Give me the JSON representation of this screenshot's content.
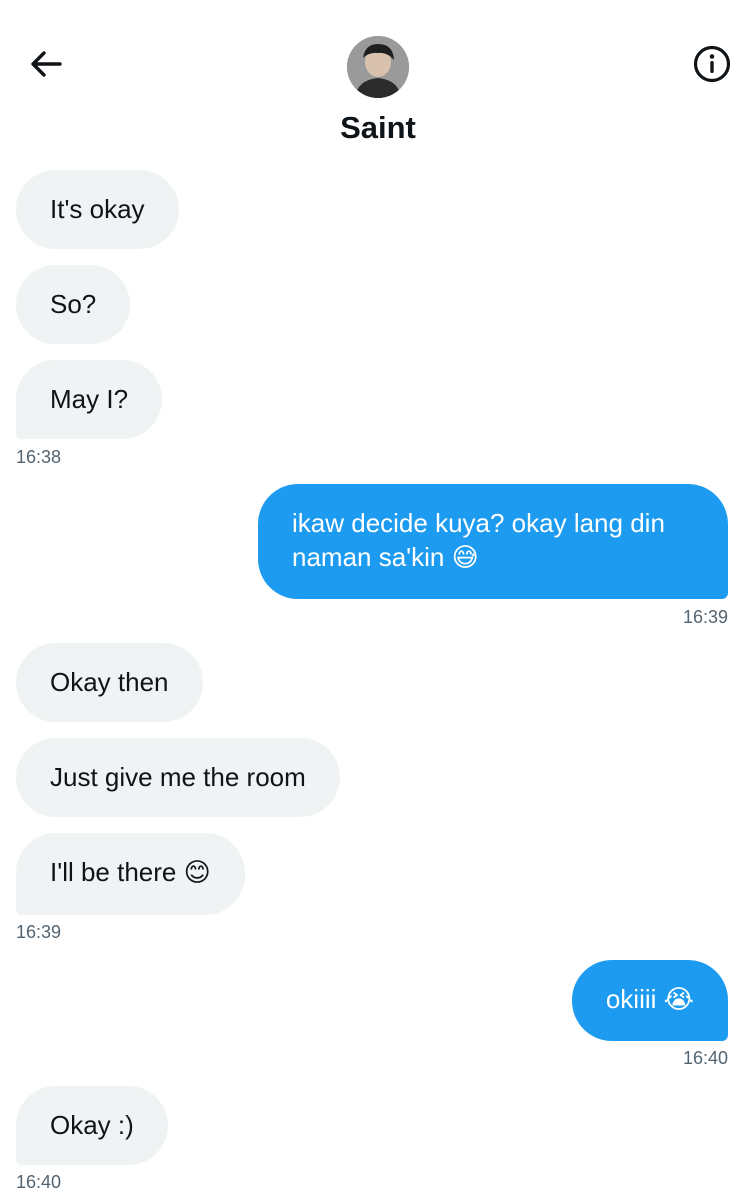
{
  "header": {
    "contact_name": "Saint"
  },
  "messages": [
    {
      "text": "It's okay"
    },
    {
      "text": "So?"
    },
    {
      "text": "May I?"
    },
    {
      "time": "16:38"
    },
    {
      "text": "ikaw decide kuya? okay lang din naman sa'kin 😅"
    },
    {
      "time": "16:39"
    },
    {
      "text": "Okay then"
    },
    {
      "text": "Just give me the room"
    },
    {
      "text": "I'll be there 😊"
    },
    {
      "time": "16:39"
    },
    {
      "text": "okiiii 😭"
    },
    {
      "time": "16:40"
    },
    {
      "text": "Okay :)"
    },
    {
      "time": "16:40"
    }
  ],
  "colors": {
    "outgoing_bubble": "#1d9bf0",
    "incoming_bubble": "#eff3f4",
    "timestamp": "#536471"
  },
  "icons": {
    "back": "back-arrow-icon",
    "info": "info-icon"
  }
}
